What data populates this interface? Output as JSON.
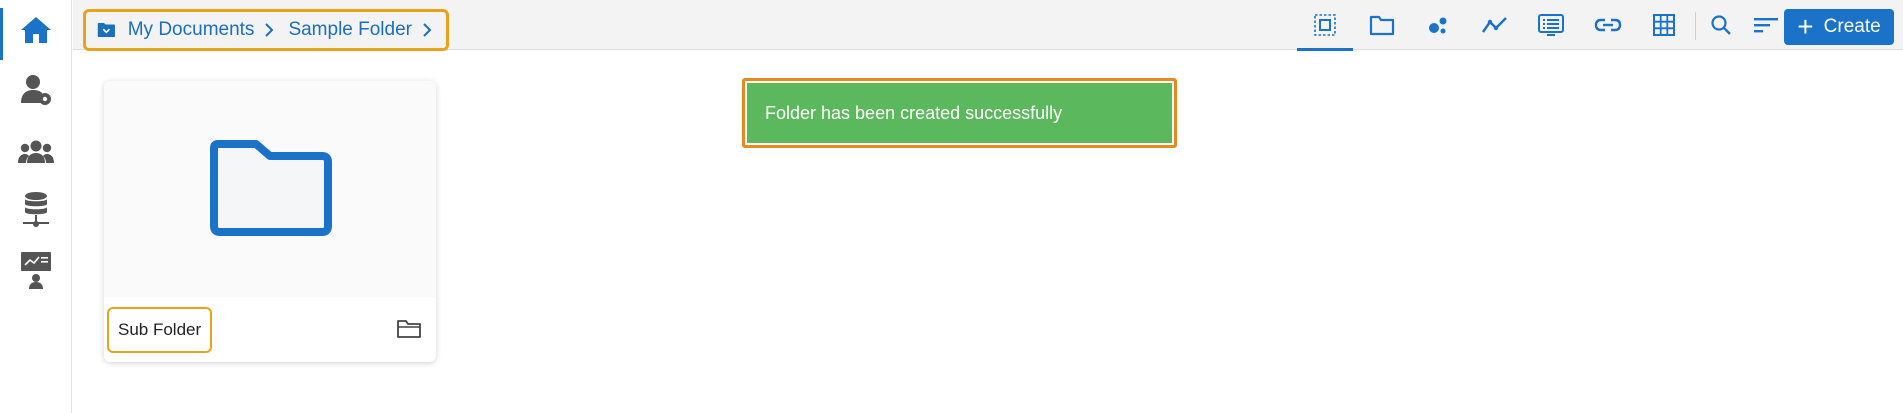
{
  "breadcrumb": {
    "items": [
      "My Documents",
      "Sample Folder"
    ]
  },
  "toolbar": {
    "tools": [
      "select-all-icon",
      "folder-icon",
      "scatter-icon",
      "line-chart-icon",
      "list-icon",
      "link-icon",
      "grid-icon"
    ],
    "create_label": "Create"
  },
  "sidebar": {
    "items": [
      "home-icon",
      "user-settings-icon",
      "users-group-icon",
      "database-network-icon",
      "presentation-icon"
    ]
  },
  "main": {
    "cards": [
      {
        "name": "Sub Folder",
        "type_icon": "folder-outline-icon"
      }
    ]
  },
  "toast": {
    "message": "Folder has been created successfully"
  },
  "colors": {
    "accent": "#1a73c8",
    "highlight": "#e9a21a",
    "toast_bg": "#5cb85c",
    "icon_gray": "#555555"
  }
}
